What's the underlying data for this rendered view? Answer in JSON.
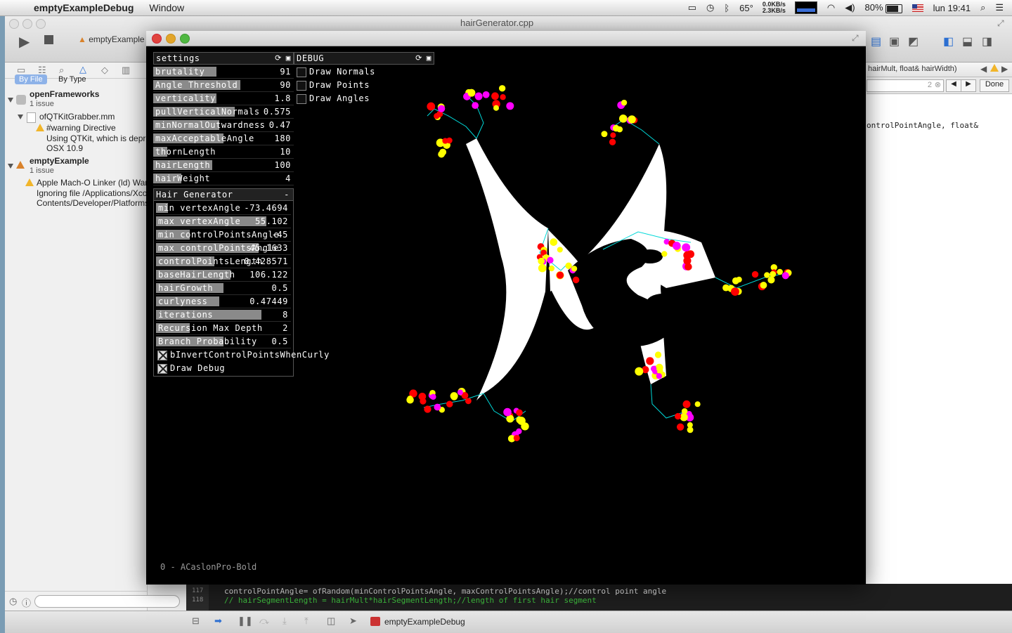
{
  "menubar": {
    "app_name": "emptyExampleDebug",
    "menus": [
      "Window"
    ],
    "status": {
      "temperature": "65°",
      "net_up": "0.0KB/s",
      "net_down": "2.3KB/s",
      "battery": "80%",
      "clock": "lun 19:41"
    }
  },
  "xcode": {
    "file_title": "hairGenerator.cpp",
    "scheme": "emptyExample",
    "jump_bar_tail": "hairMult, float& hairWidth)",
    "find": {
      "count": "2",
      "done_label": "Done"
    },
    "code_fragment": "ontrolPointAngle, float&",
    "navigator": {
      "segments": [
        "By File",
        "By Type"
      ],
      "items": [
        {
          "title": "openFrameworks",
          "sub": "1 issue"
        },
        {
          "title": "ofQTKitGrabber.mm"
        },
        {
          "title": "#warning Directive",
          "detail1": "Using QTKit, which is deprecated",
          "detail2": "OSX 10.9"
        },
        {
          "title": "emptyExample",
          "sub": "1 issue"
        },
        {
          "title": "Apple Mach-O Linker (ld) Warning",
          "detail1": "Ignoring file /Applications/Xcode",
          "detail2": "Contents/Developer/Platforms"
        }
      ]
    },
    "code_lines": [
      {
        "num": "117",
        "text": "    controlPointAngle= ofRandom(minControlPointsAngle, maxControlPointsAngle);//control point angle"
      },
      {
        "num": "118",
        "text": "  //  hairSegmentLength = hairMult*hairSegmentLength;//length of first hair segment"
      }
    ],
    "bottom_target": "emptyExampleDebug"
  },
  "ofapp": {
    "settings_panel": {
      "title": "settings",
      "sliders": [
        {
          "label": "brutality",
          "value": "91",
          "fill": 0.45
        },
        {
          "label": "Angle Threshold",
          "value": "90",
          "fill": 0.62
        },
        {
          "label": "verticality",
          "value": "1.8",
          "fill": 0.45
        },
        {
          "label": "pullVerticalNormals",
          "value": "0.575",
          "fill": 0.58
        },
        {
          "label": "minNormalOutwardness",
          "value": "0.47",
          "fill": 0.47
        },
        {
          "label": "maxAcceptableAngle",
          "value": "180",
          "fill": 0.5
        },
        {
          "label": "thornLength",
          "value": "10",
          "fill": 0.1
        },
        {
          "label": "hairLength",
          "value": "100",
          "fill": 0.42
        },
        {
          "label": "hairWeight",
          "value": "4",
          "fill": 0.2
        }
      ]
    },
    "debug_panel": {
      "title": "DEBUG",
      "toggles": [
        {
          "label": "Draw Normals",
          "on": false
        },
        {
          "label": "Draw Points",
          "on": false
        },
        {
          "label": "Draw Angles",
          "on": false
        }
      ]
    },
    "hair_panel": {
      "title": "Hair Generator",
      "collapse": "-",
      "sliders": [
        {
          "label": "min vertexAngle",
          "value": "-73.4694",
          "fill": 0.09
        },
        {
          "label": "max vertexAngle",
          "value": "55.102",
          "fill": 0.82
        },
        {
          "label": "min controlPointsAngle",
          "value": "-45",
          "fill": 0.25
        },
        {
          "label": "max controlPointsAngle",
          "value": "45.1633",
          "fill": 0.76
        },
        {
          "label": "controlPointsLength",
          "value": "0.428571",
          "fill": 0.43
        },
        {
          "label": "baseHairLength",
          "value": "106.122",
          "fill": 0.55
        },
        {
          "label": "hairGrowth",
          "value": "0.5",
          "fill": 0.5
        },
        {
          "label": "curlyness",
          "value": "0.47449",
          "fill": 0.47
        },
        {
          "label": "iterations",
          "value": "8",
          "fill": 0.78
        },
        {
          "label": "Recursion Max Depth",
          "value": "2",
          "fill": 0.25
        },
        {
          "label": "Branch Probability",
          "value": "0.5",
          "fill": 0.5
        }
      ],
      "toggles": [
        {
          "label": "bInvertControlPointsWhenCurly",
          "on": true
        },
        {
          "label": "Draw Debug",
          "on": true
        }
      ]
    },
    "font_caption": "0 - ACaslonPro-Bold",
    "colors": {
      "node_red": "#ff0000",
      "node_yellow": "#ffff00",
      "node_magenta": "#ff00ff",
      "debug_line": "#00d8d8"
    }
  }
}
